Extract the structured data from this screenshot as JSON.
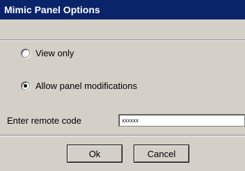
{
  "window": {
    "title": "Mimic Panel Options"
  },
  "options": [
    {
      "label": "View only",
      "selected": false
    },
    {
      "label": "Allow panel modifications",
      "selected": true
    }
  ],
  "remote_code": {
    "label": "Enter remote code",
    "value": "xxxxxx"
  },
  "buttons": {
    "ok": "Ok",
    "cancel": "Cancel"
  }
}
